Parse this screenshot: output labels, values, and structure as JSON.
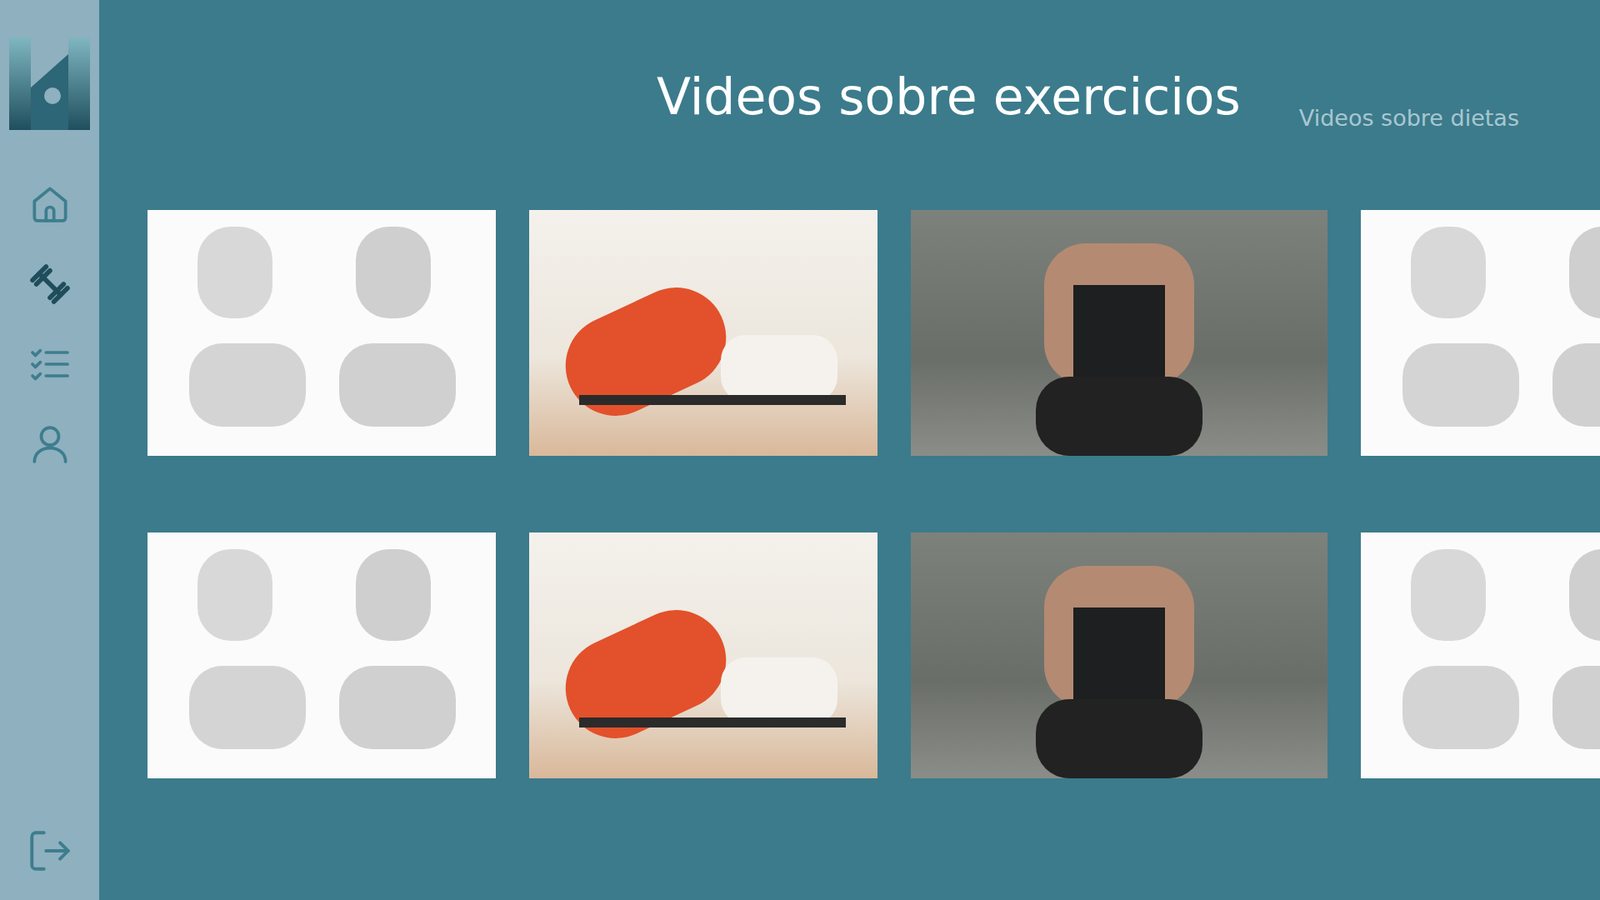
{
  "page": {
    "title": "Videos sobre exercicios",
    "alt_link": "Videos sobre dietas"
  },
  "sidebar": {
    "items": [
      {
        "selected": false
      },
      {
        "selected": true
      },
      {
        "selected": false
      },
      {
        "selected": false
      }
    ]
  },
  "videos": {
    "rows": [
      [
        {
          "kind": "illustration"
        },
        {
          "kind": "photo-light"
        },
        {
          "kind": "photo-dark"
        },
        {
          "kind": "illustration"
        }
      ],
      [
        {
          "kind": "illustration"
        },
        {
          "kind": "photo-light"
        },
        {
          "kind": "photo-dark"
        },
        {
          "kind": "illustration"
        }
      ]
    ]
  }
}
